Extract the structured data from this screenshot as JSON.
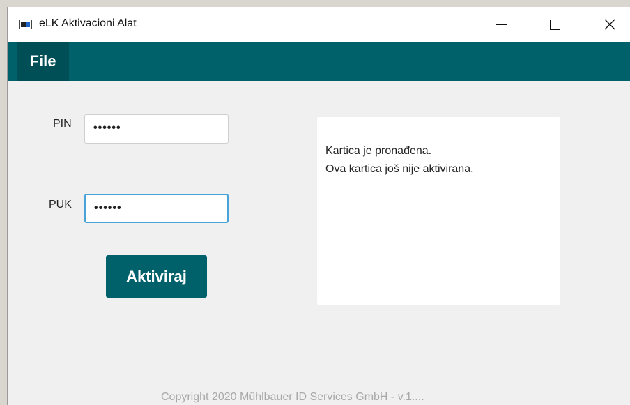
{
  "window": {
    "title": "eLK Aktivacioni Alat",
    "icon": "app-window-icon",
    "accent_color": "#00616a"
  },
  "menu": {
    "file_label": "File"
  },
  "form": {
    "pin_label": "PIN",
    "pin_value": "••••••",
    "puk_label": "PUK",
    "puk_value": "••••••",
    "activate_label": "Aktiviraj"
  },
  "status": {
    "line1": "Kartica je pronađena.",
    "line2": "Ova kartica još nije aktivirana."
  },
  "footer": {
    "copyright": "Copyright 2020 Mühlbauer ID Services GmbH - v.1...."
  }
}
